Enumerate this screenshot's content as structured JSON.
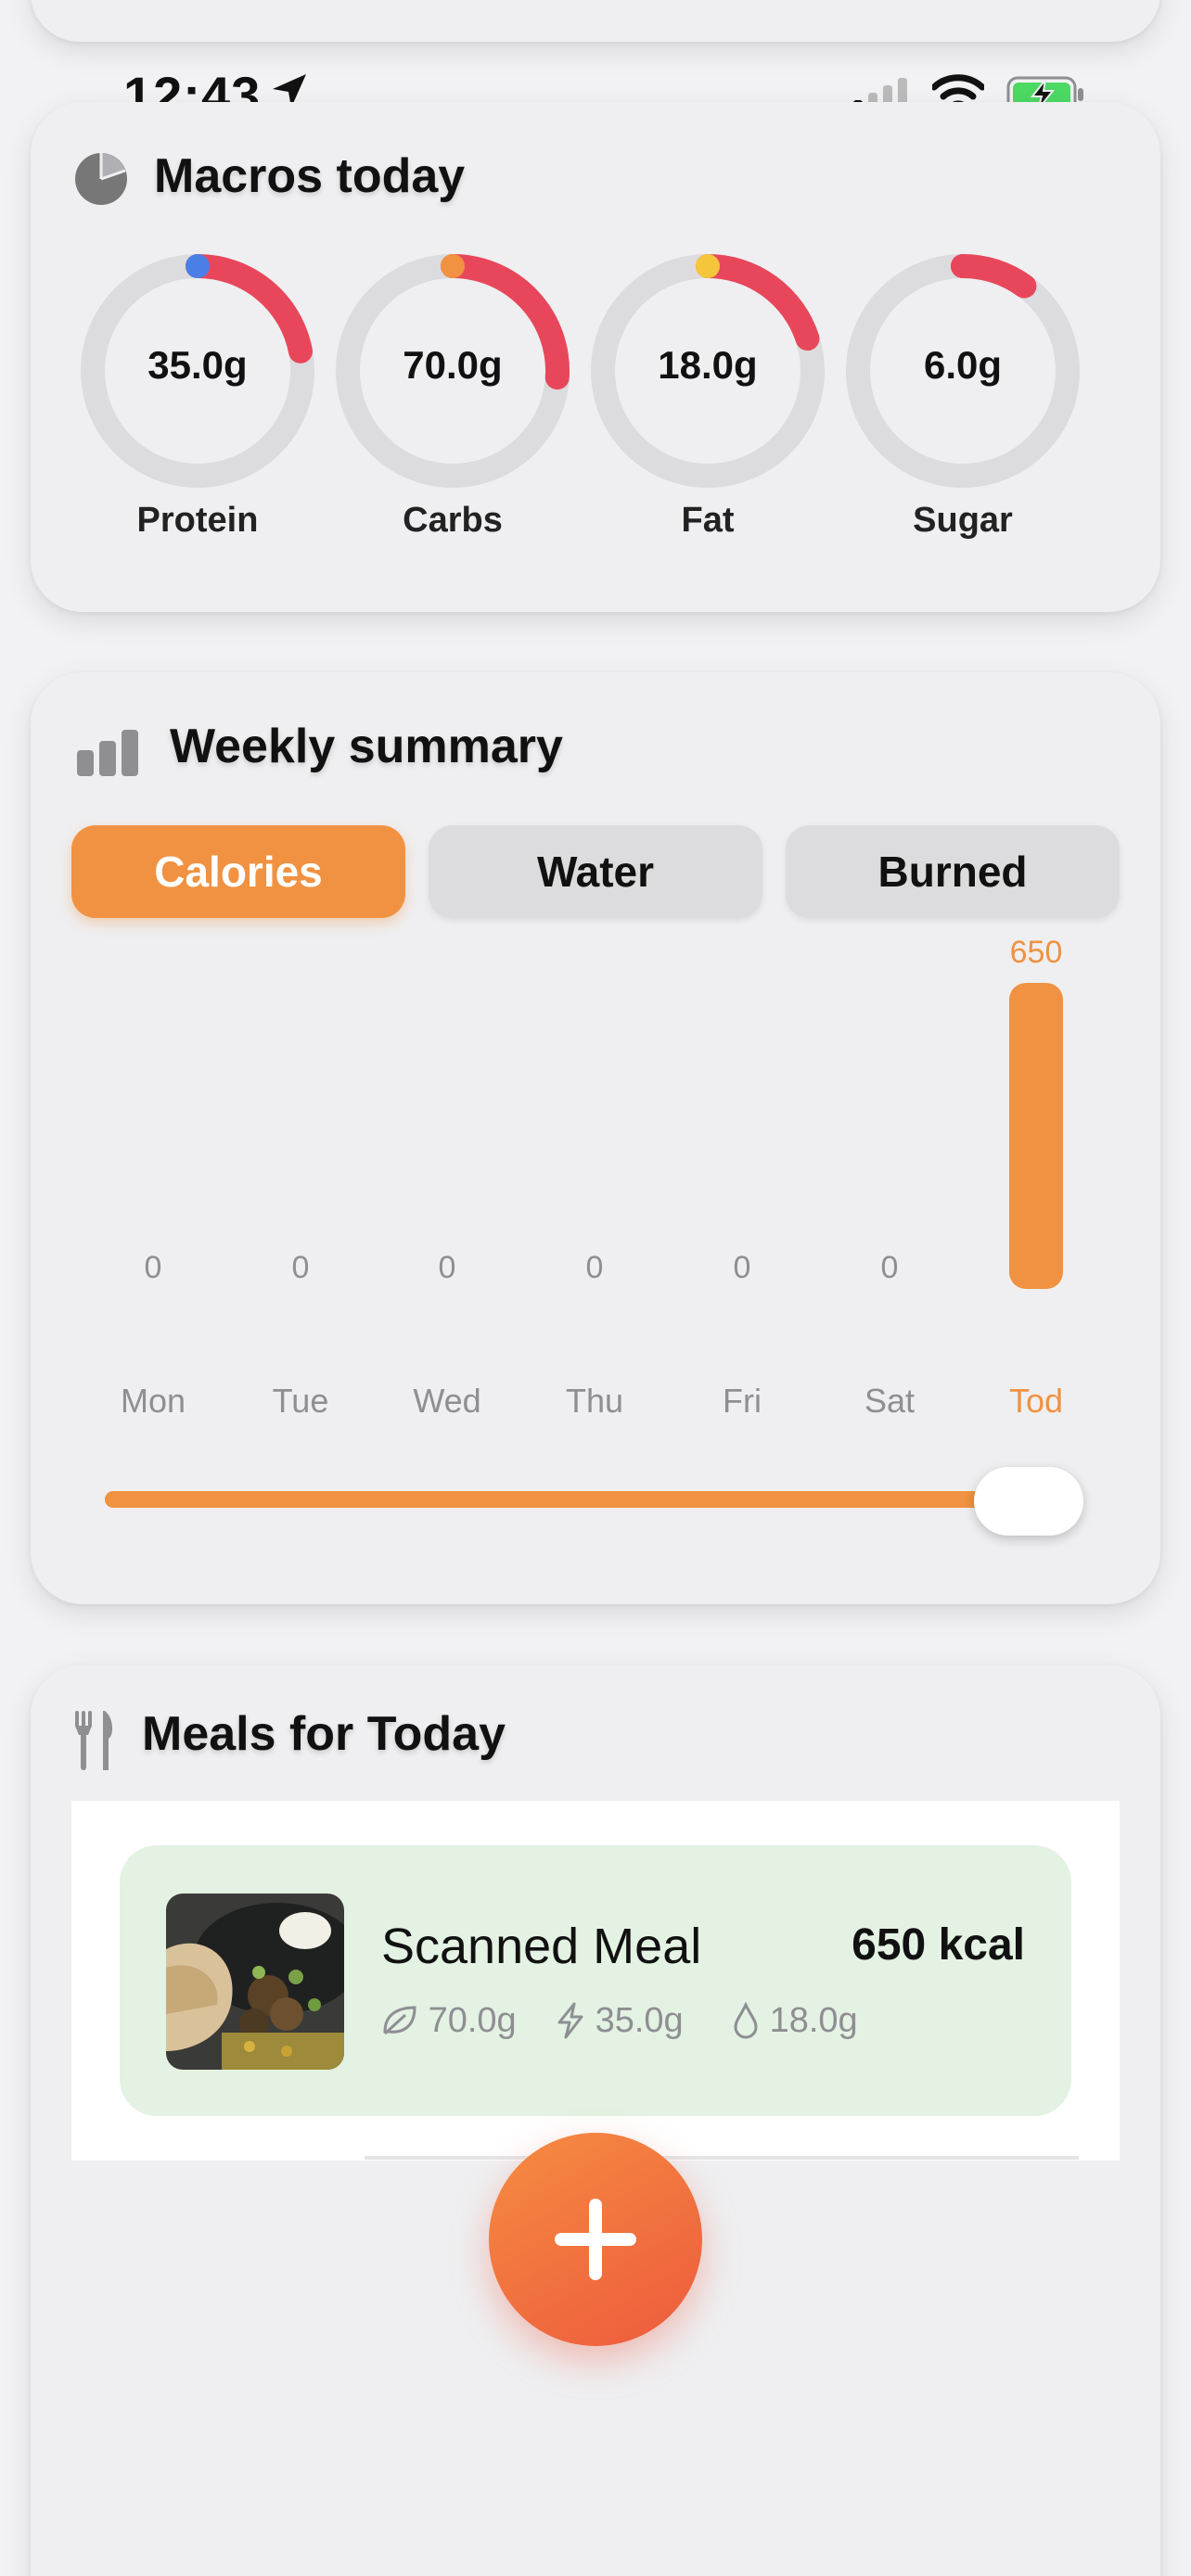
{
  "status_bar": {
    "time": "12:43"
  },
  "macros": {
    "title": "Macros today",
    "items": [
      {
        "label": "Protein",
        "value": "35.0g",
        "progress": 0.22,
        "start_color": "#4a7fe6"
      },
      {
        "label": "Carbs",
        "value": "70.0g",
        "progress": 0.26,
        "start_color": "#f09241"
      },
      {
        "label": "Fat",
        "value": "18.0g",
        "progress": 0.2,
        "start_color": "#f5c63c"
      },
      {
        "label": "Sugar",
        "value": "6.0g",
        "progress": 0.1,
        "start_color": "#e8475b"
      }
    ]
  },
  "weekly": {
    "title": "Weekly summary",
    "tabs": [
      "Calories",
      "Water",
      "Burned"
    ],
    "active_tab": "Calories",
    "accent_color": "#f09241"
  },
  "chart_data": {
    "type": "bar",
    "categories": [
      "Mon",
      "Tue",
      "Wed",
      "Thu",
      "Fri",
      "Sat",
      "Tod"
    ],
    "values": [
      0,
      0,
      0,
      0,
      0,
      0,
      650
    ],
    "value_labels": [
      "0",
      "0",
      "0",
      "0",
      "0",
      "0",
      "650"
    ],
    "highlight_index": 6
  },
  "slider": {
    "value": 0.98
  },
  "meals": {
    "title": "Meals for Today",
    "items": [
      {
        "name": "Scanned Meal",
        "kcal": "650 kcal",
        "carbs": "70.0g",
        "protein": "35.0g",
        "fat": "18.0g",
        "background": "#e3f2e2"
      }
    ]
  },
  "icons": {
    "macros": "pie-chart-icon",
    "weekly": "bar-chart-icon",
    "meals": "fork-knife-icon",
    "add": "plus-icon"
  }
}
